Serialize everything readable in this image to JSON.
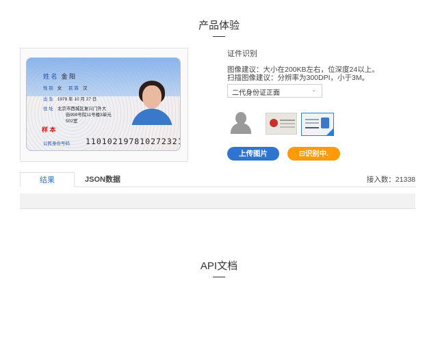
{
  "sections": {
    "product_title": "产品体验",
    "api_title": "API文档"
  },
  "id_card": {
    "name_label": "姓 名",
    "name_value": "金 阳",
    "gender_label": "性 别",
    "gender_value": "女",
    "ethnicity_label": "民 族",
    "ethnicity_value": "汉",
    "birth_label": "出 生",
    "birth_value": "1978 年 10 月 27 日",
    "address_label": "住 址",
    "address_line1": "北京市西城区复兴门外大",
    "address_line2": "街999号院11号楼3单元",
    "address_line3": "502室",
    "stamp_text": "样 本",
    "number_label": "公民身份号码",
    "number_value": "110102197810272321"
  },
  "panel": {
    "label": "证件识别",
    "hint_line1": "图像建议：大小在200KB左右，位深度24以上。",
    "hint_line2": "扫描图像建议：分辨率为300DPI，小于3M。",
    "select_value": "二代身份证正面",
    "upload_button": "上传图片",
    "recognize_button": "识别中."
  },
  "tabs": {
    "result": "结果",
    "json": "JSON数据",
    "access_count": "接入数：21338"
  },
  "colors": {
    "accent_blue": "#2f74d0",
    "accent_orange": "#ff9a0a"
  }
}
